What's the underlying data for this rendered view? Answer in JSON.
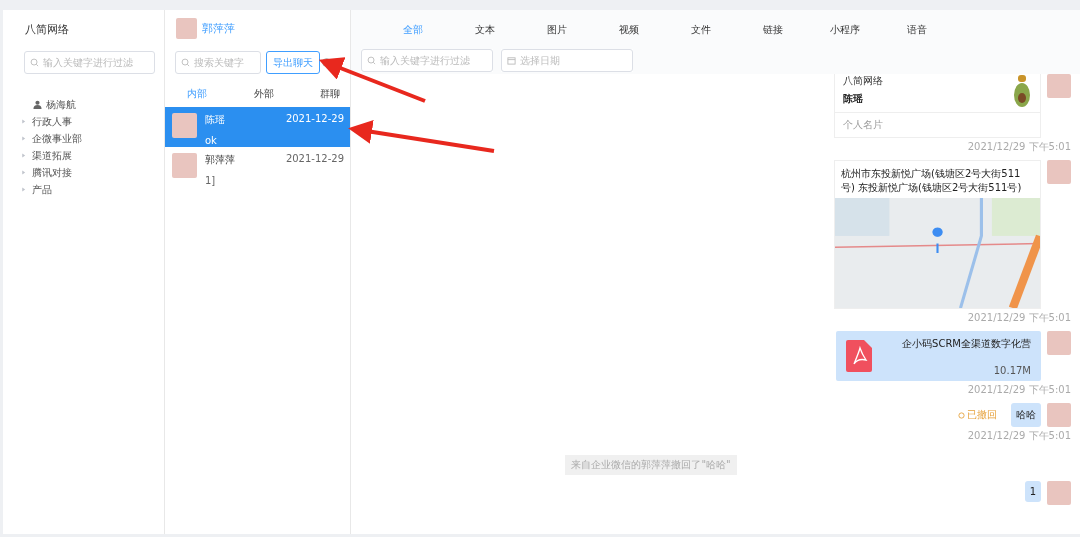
{
  "sidebar": {
    "title": "八简网络",
    "search": {
      "placeholder": "输入关键字进行过滤"
    },
    "tree": [
      {
        "kind": "person",
        "label": "杨海航"
      },
      {
        "kind": "department",
        "label": "行政人事",
        "expanded": false
      },
      {
        "kind": "department",
        "label": "企微事业部",
        "expanded": false
      },
      {
        "kind": "department",
        "label": "渠道拓展",
        "expanded": false
      },
      {
        "kind": "department",
        "label": "腾讯对接",
        "expanded": false
      },
      {
        "kind": "department",
        "label": "产品",
        "expanded": false
      }
    ]
  },
  "contacts": {
    "current_user": "郭萍萍",
    "search": {
      "placeholder": "搜索关键字"
    },
    "export_button": "导出聊天",
    "tabs": [
      {
        "label": "内部",
        "selected": true
      },
      {
        "label": "外部",
        "selected": false
      },
      {
        "label": "群聊",
        "selected": false
      }
    ],
    "conversations": [
      {
        "name": "陈瑶",
        "preview": "ok",
        "date": "2021-12-29",
        "selected": true
      },
      {
        "name": "郭萍萍",
        "preview": "1]",
        "date": "2021-12-29",
        "selected": false
      }
    ]
  },
  "chat": {
    "tabs": [
      {
        "label": "全部",
        "selected": true
      },
      {
        "label": "文本",
        "selected": false
      },
      {
        "label": "图片",
        "selected": false
      },
      {
        "label": "视频",
        "selected": false
      },
      {
        "label": "文件",
        "selected": false
      },
      {
        "label": "链接",
        "selected": false
      },
      {
        "label": "小程序",
        "selected": false
      },
      {
        "label": "语音",
        "selected": false
      }
    ],
    "search": {
      "placeholder": "输入关键字进行过滤"
    },
    "date_picker": {
      "placeholder": "选择日期"
    },
    "messages": [
      {
        "kind": "card",
        "org": "八简网络",
        "name": "陈瑶",
        "footer": "个人名片",
        "timestamp": "2021/12/29 下午5:01"
      },
      {
        "kind": "location",
        "address": "杭州市东投新悦广场(钱塘区2号大街511号) 东投新悦广场(钱塘区2号大街511号)",
        "timestamp": "2021/12/29 下午5:01"
      },
      {
        "kind": "file",
        "filename": "企小码SCRM全渠道数字化营",
        "size": "10.17M",
        "timestamp": "2021/12/29 下午5:01"
      },
      {
        "kind": "text",
        "text": "哈哈",
        "recalled": true,
        "recalled_label": "已撤回",
        "timestamp": "2021/12/29 下午5:01"
      },
      {
        "kind": "notice",
        "text": "来自企业微信的郭萍萍撤回了\"哈哈\""
      },
      {
        "kind": "text",
        "text": "1",
        "recalled": false
      }
    ]
  }
}
